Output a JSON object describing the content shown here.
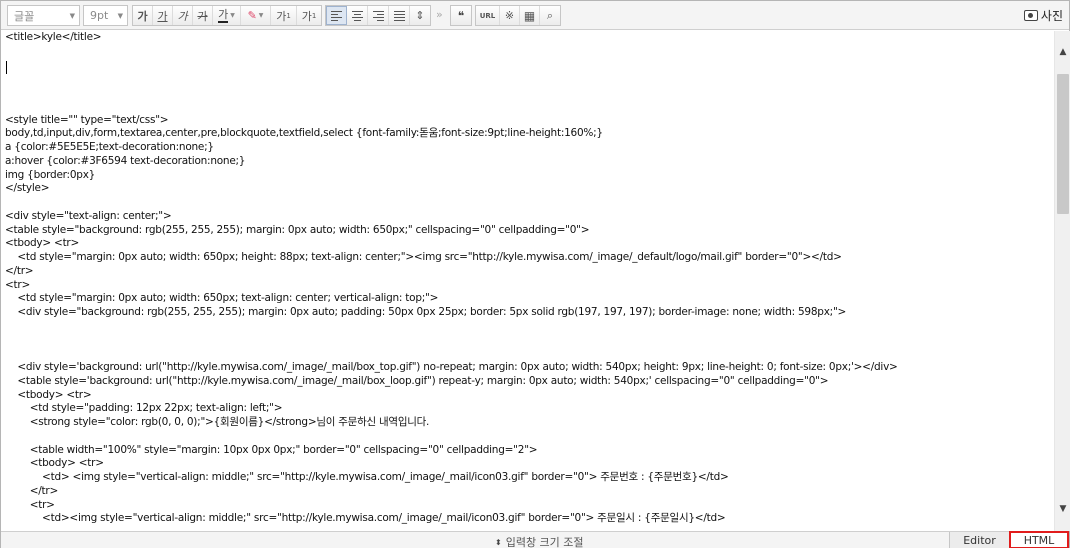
{
  "toolbar": {
    "font_select": "글꼴",
    "size_select": "9pt",
    "bold": "가",
    "underline": "가",
    "italic": "가",
    "strike": "가",
    "font_color": "가",
    "sup": "가",
    "sub": "가",
    "more": "»",
    "quote": "❝",
    "url": "URL",
    "photo_label": "사진"
  },
  "editor": {
    "lines": [
      "<title>kyle</title>",
      "",
      "",
      "",
      "",
      "",
      "<style title=\"\" type=\"text/css\">",
      "body,td,input,div,form,textarea,center,pre,blockquote,textfield,select {font-family:돋움;font-size:9pt;line-height:160%;}",
      "a {color:#5E5E5E;text-decoration:none;}",
      "a:hover {color:#3F6594 text-decoration:none;}",
      "img {border:0px}",
      "</style>",
      "",
      "<div style=\"text-align: center;\">",
      "<table style=\"background: rgb(255, 255, 255); margin: 0px auto; width: 650px;\" cellspacing=\"0\" cellpadding=\"0\">",
      "<tbody> <tr>",
      "    <td style=\"margin: 0px auto; width: 650px; height: 88px; text-align: center;\"><img src=\"http://kyle.mywisa.com/_image/_default/logo/mail.gif\" border=\"0\"></td>",
      "</tr>",
      "<tr>",
      "    <td style=\"margin: 0px auto; width: 650px; text-align: center; vertical-align: top;\">",
      "    <div style=\"background: rgb(255, 255, 255); margin: 0px auto; padding: 50px 0px 25px; border: 5px solid rgb(197, 197, 197); border-image: none; width: 598px;\">",
      "",
      "",
      "",
      "    <div style='background: url(\"http://kyle.mywisa.com/_image/_mail/box_top.gif\") no-repeat; margin: 0px auto; width: 540px; height: 9px; line-height: 0; font-size: 0px;'></div>",
      "    <table style='background: url(\"http://kyle.mywisa.com/_image/_mail/box_loop.gif\") repeat-y; margin: 0px auto; width: 540px;' cellspacing=\"0\" cellpadding=\"0\">",
      "    <tbody> <tr>",
      "        <td style=\"padding: 12px 22px; text-align: left;\">",
      "        <strong style=\"color: rgb(0, 0, 0);\">{회원이름}</strong>님이 주문하신 내역입니다.",
      "",
      "        <table width=\"100%\" style=\"margin: 10px 0px 0px;\" border=\"0\" cellspacing=\"0\" cellpadding=\"2\">",
      "        <tbody> <tr>",
      "            <td> <img style=\"vertical-align: middle;\" src=\"http://kyle.mywisa.com/_image/_mail/icon03.gif\" border=\"0\"> 주문번호 : {주문번호}</td>",
      "        </tr>",
      "        <tr>",
      "            <td><img style=\"vertical-align: middle;\" src=\"http://kyle.mywisa.com/_image/_mail/icon03.gif\" border=\"0\"> 주문일시 : {주문일시}</td>"
    ]
  },
  "statusbar": {
    "resize_label": "입력창 크기 조절",
    "editor_tab": "Editor",
    "html_tab": "HTML"
  }
}
